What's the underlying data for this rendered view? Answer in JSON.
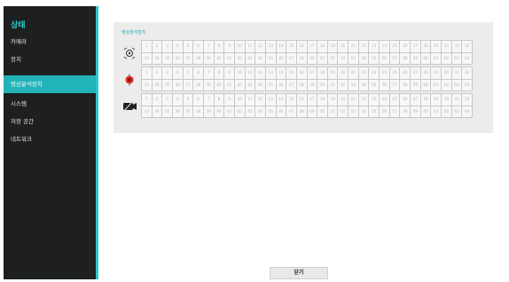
{
  "sidebar": {
    "title": "상태",
    "items": [
      {
        "label": "카메라",
        "active": false
      },
      {
        "label": "장치",
        "active": false
      },
      {
        "label": "영상분석장치",
        "active": true
      },
      {
        "label": "시스템",
        "active": false
      },
      {
        "label": "저장 공간",
        "active": false
      },
      {
        "label": "네트워크",
        "active": false
      }
    ]
  },
  "panel": {
    "title": "영상분석장치",
    "rows": [
      {
        "icon": "motion-detection-icon"
      },
      {
        "icon": "alarm-in-icon"
      },
      {
        "icon": "video-loss-icon"
      }
    ],
    "channel_numbers": [
      1,
      2,
      3,
      4,
      5,
      6,
      7,
      8,
      9,
      10,
      11,
      12,
      13,
      14,
      15,
      16,
      17,
      18,
      19,
      20,
      21,
      22,
      23,
      24,
      25,
      26,
      27,
      28,
      29,
      30,
      31,
      32,
      33,
      34,
      35,
      36,
      37,
      38,
      39,
      40,
      41,
      42,
      43,
      44,
      45,
      46,
      47,
      48,
      49,
      50,
      51,
      52,
      53,
      54,
      55,
      56,
      57,
      58,
      59,
      60,
      61,
      62,
      63,
      64
    ]
  },
  "footer": {
    "close_label": "닫기"
  },
  "colors": {
    "sidebar_bg": "#1d1f20",
    "accent": "#2cc6c6",
    "active_item": "#22b3b8",
    "alarm_red": "#d63027"
  }
}
